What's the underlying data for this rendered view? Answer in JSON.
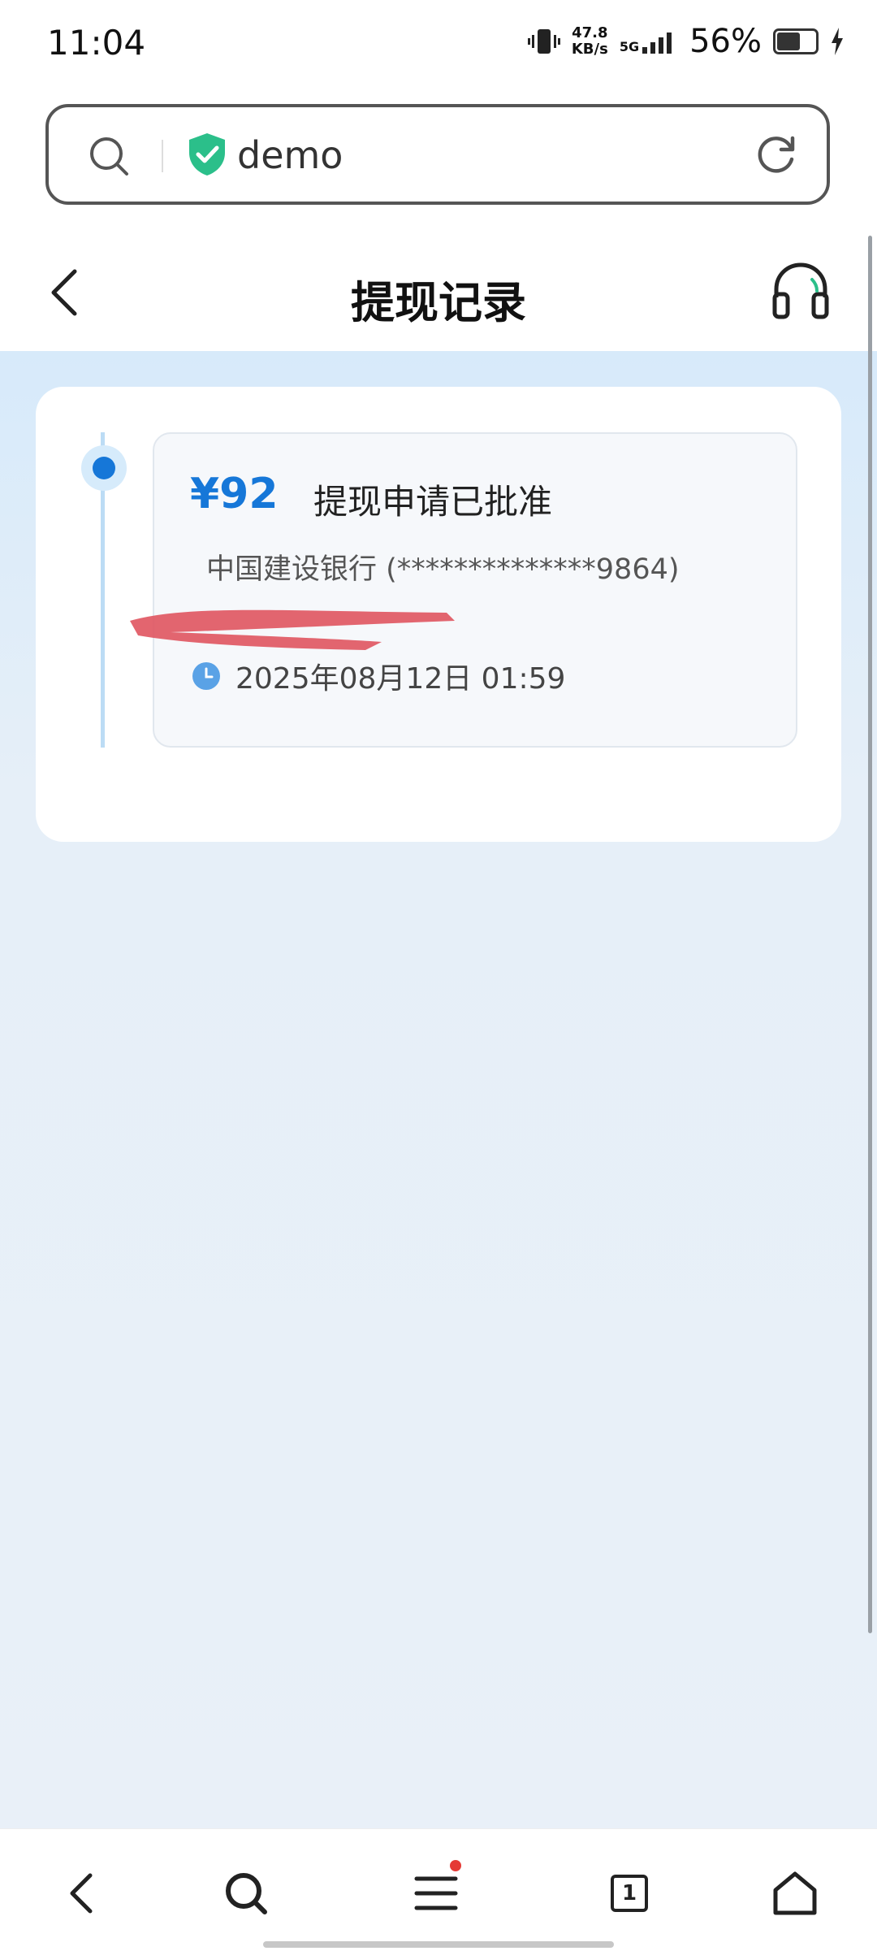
{
  "status_bar": {
    "time": "11:04",
    "net_speed_value": "47.8",
    "net_speed_unit": "KB/s",
    "network": "5G",
    "battery_percent": "56%"
  },
  "url_bar": {
    "url_text": "demo",
    "secure": true
  },
  "header": {
    "title": "提现记录"
  },
  "records": [
    {
      "amount": "¥92",
      "status": "提现申请已批准",
      "bank": "中国建设银行 (**************9864)",
      "date": "2025年08月12日 01:59"
    }
  ],
  "bottom_nav": {
    "tab_count": "1",
    "menu_badge": true
  },
  "colors": {
    "accent": "#1677d8",
    "badge": "#e53935",
    "secure_shield": "#2bbf8a"
  }
}
